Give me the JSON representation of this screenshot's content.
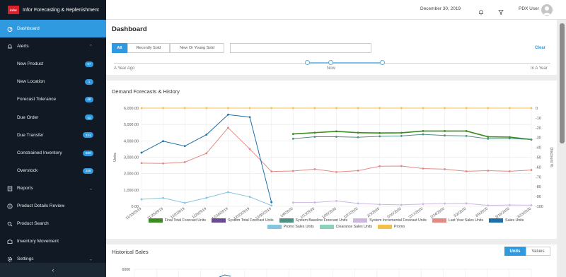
{
  "app": {
    "logo_text": "infor",
    "title": "Infor Forecasting & Replenishment"
  },
  "topbar": {
    "date": "December 30, 2019",
    "user": "PDX User"
  },
  "sidebar": {
    "dashboard": "Dashboard",
    "alerts": "Alerts",
    "alert_items": [
      {
        "label": "New Product",
        "count": "67"
      },
      {
        "label": "New Location",
        "count": "1"
      },
      {
        "label": "Forecast Tolerance",
        "count": "49"
      },
      {
        "label": "Due Order",
        "count": "42"
      },
      {
        "label": "Due Transfer",
        "count": "224"
      },
      {
        "label": "Constrained Inventory",
        "count": "589"
      },
      {
        "label": "Overstock",
        "count": "338"
      }
    ],
    "reports": "Reports",
    "product_details_review": "Product Details Review",
    "product_search": "Product Search",
    "inventory_movement": "Inventory Movement",
    "settings": "Settings",
    "collapse_glyph": "‹"
  },
  "dashboard": {
    "title": "Dashboard",
    "tabs": [
      "All",
      "Recently Sold",
      "New Or Young Sold"
    ],
    "search_placeholder": "",
    "clear": "Clear",
    "range_labels": {
      "left": "A Year Ago",
      "middle": "Now",
      "right": "In A Year"
    }
  },
  "demand": {
    "title": "Demand Forecasts & History",
    "legend": [
      {
        "name": "Final Total Forecast Units",
        "color": "#3c8a20"
      },
      {
        "name": "System Total Forecast Units",
        "color": "#6a4c93"
      },
      {
        "name": "System Baseline Forecast Units",
        "color": "#4e8f84"
      },
      {
        "name": "System Incremental Forecast Units",
        "color": "#cdb8e0"
      },
      {
        "name": "Last Year Sales Units",
        "color": "#e48a84"
      },
      {
        "name": "Sales Units",
        "color": "#1f6fa8"
      },
      {
        "name": "Promo Sales Units",
        "color": "#86c5e0"
      },
      {
        "name": "Clearance Sales Units",
        "color": "#8bd3b6"
      },
      {
        "name": "Promo",
        "color": "#f3c04a"
      }
    ]
  },
  "chart_data": {
    "type": "line",
    "x": [
      "11/18/2019",
      "11/25/2019",
      "12/2/2019",
      "12/9/2019",
      "12/16/2019",
      "12/23/2019",
      "12/30/2019",
      "1/6/2020",
      "1/13/2020",
      "1/20/2020",
      "1/27/2020",
      "2/3/2020",
      "2/10/2020",
      "2/17/2020",
      "2/24/2020",
      "3/2/2020",
      "3/9/2020",
      "3/16/2020",
      "3/23/2020"
    ],
    "ylabel": "Units",
    "y2label": "Discount %",
    "ylim": [
      0,
      6000
    ],
    "yticks": [
      "0.00",
      "1,000.00",
      "2,000.00",
      "3,000.00",
      "4,000.00",
      "5,000.00",
      "6,000.00"
    ],
    "y2lim": [
      -100,
      0
    ],
    "y2ticks": [
      "0",
      "-10",
      "-20",
      "-30",
      "-40",
      "-50",
      "-60",
      "-70",
      "-80",
      "-90",
      "-100"
    ],
    "grid": true,
    "legend_position": "bottom",
    "series": [
      {
        "name": "Final Total Forecast Units",
        "color": "#3c8a20",
        "values": [
          null,
          null,
          null,
          null,
          null,
          null,
          null,
          4420,
          4500,
          4580,
          4500,
          4480,
          4490,
          4600,
          4600,
          4600,
          4250,
          4230,
          4080,
          4090
        ]
      },
      {
        "name": "System Baseline Forecast Units",
        "color": "#4e8f84",
        "values": [
          null,
          null,
          null,
          null,
          null,
          null,
          null,
          4130,
          4250,
          4250,
          4220,
          4280,
          4300,
          4400,
          4330,
          4300,
          4130,
          4150,
          4080,
          4080
        ]
      },
      {
        "name": "Last Year Sales Units",
        "color": "#e48a84",
        "values": [
          2640,
          2620,
          2700,
          3240,
          4800,
          3500,
          2130,
          2160,
          2270,
          2100,
          2180,
          2450,
          2460,
          2310,
          2270,
          2140,
          2180,
          2140,
          2220,
          2420
        ]
      },
      {
        "name": "Sales Units",
        "color": "#1f6fa8",
        "values": [
          3280,
          3980,
          3680,
          4380,
          5600,
          5450,
          250
        ]
      },
      {
        "name": "Promo Sales Units",
        "color": "#86c5e0",
        "values": [
          430,
          510,
          210,
          520,
          870,
          580,
          50
        ]
      },
      {
        "name": "System Incremental Forecast Units",
        "color": "#cdb8e0",
        "values": [
          null,
          null,
          null,
          null,
          null,
          null,
          null,
          230,
          240,
          330,
          180,
          120,
          90,
          140,
          170,
          180,
          60,
          80,
          70,
          90
        ]
      },
      {
        "name": "Promo",
        "color": "#f3c04a",
        "axis": "y2",
        "values": [
          0,
          0,
          0,
          0,
          0,
          0,
          0,
          0,
          0,
          0,
          0,
          0,
          0,
          0,
          0,
          0,
          0,
          0,
          0,
          0
        ]
      }
    ]
  },
  "historical": {
    "title": "Historical Sales",
    "toggle": [
      "Units",
      "Values"
    ],
    "first_tick": "6000"
  },
  "icons": [
    "dashboard-icon",
    "bell-icon",
    "chevron-up-icon",
    "chevron-down-icon",
    "reports-icon",
    "info-icon",
    "search-icon",
    "inventory-icon",
    "settings-icon",
    "filter-icon"
  ]
}
